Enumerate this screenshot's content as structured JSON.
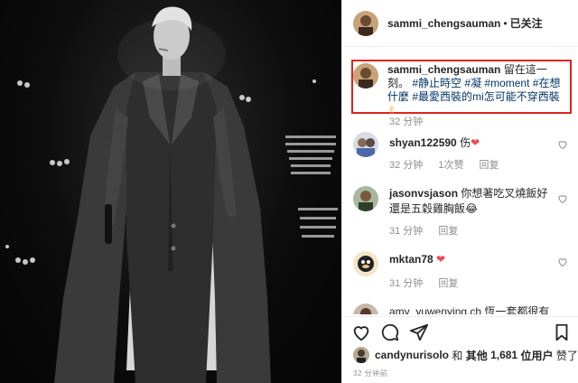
{
  "post": {
    "username": "sammi_chengsauman",
    "separator": "•",
    "follow_label": "已关注"
  },
  "caption": {
    "username": "sammi_chengsauman",
    "text": "留在這一刻。",
    "tag1": "#静止時空",
    "tag2": "#凝",
    "tag3": "#moment",
    "tag4": "#在想什麼",
    "tag5": "#",
    "tag6": "最愛西裝的mi怎可能不穿西裝",
    "emoji": "✌",
    "time": "32 分钟"
  },
  "comments": [
    {
      "username": "shyan122590",
      "text": "伤",
      "emoji": "❤",
      "time": "32 分钟",
      "likes": "1次赞",
      "reply": "回复"
    },
    {
      "username": "jasonvsjason",
      "text": "你想著吃叉燒飯好還是五穀雞胸飯",
      "emoji": "😂",
      "time": "31 分钟",
      "reply": "回复"
    },
    {
      "username": "mktan78",
      "text": "",
      "emoji": "❤",
      "time": "31 分钟",
      "reply": "回复"
    },
    {
      "username": "amy_yuwenying.ch",
      "text": "恆一套都很有"
    }
  ],
  "likes": {
    "first_user": "candynurisolo",
    "and": "和",
    "others_label": "其他",
    "count": "1,681",
    "suffix": "位用户",
    "liked": "赞了"
  },
  "posted_time": "32 分钟前",
  "icons": {
    "like": "heart-outline-icon",
    "comment": "comment-bubble-icon",
    "share": "paper-plane-icon",
    "save": "bookmark-icon"
  },
  "colors": {
    "highlight_border": "#e0241b",
    "hashtag": "#003569",
    "heart": "#ed4956",
    "muted": "#8e8e8e"
  }
}
